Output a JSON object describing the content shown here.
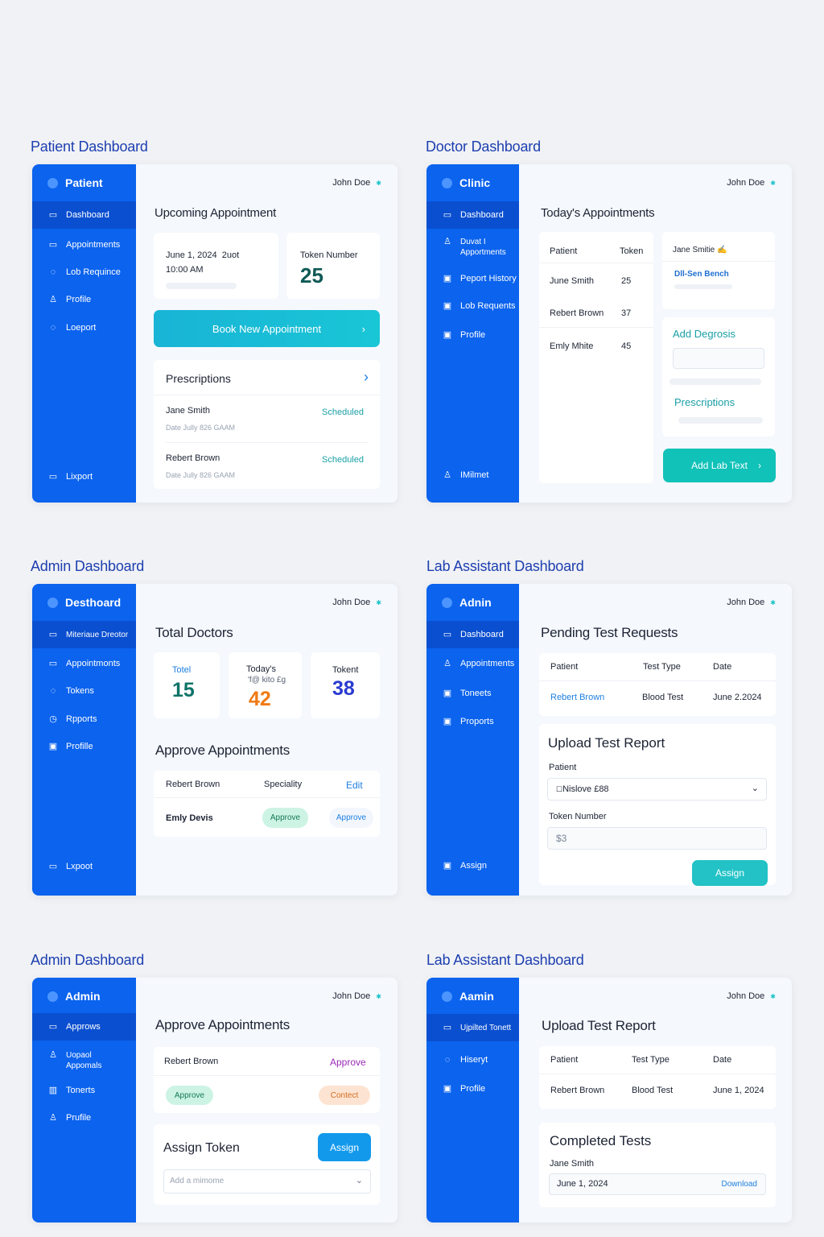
{
  "colors": {
    "sidebar": "#0b63ee",
    "sidebar_active": "#0a4fd0",
    "teal": "#1a9fa5",
    "title": "#1d3fb0"
  },
  "patient": {
    "section_title": "Patient Dashboard",
    "brand": "Patient",
    "nav": [
      "Dashboard",
      "Appointments",
      "Lob Requince",
      "Profile",
      "Loeport"
    ],
    "footer": "Lixport",
    "user": "John Doe",
    "heading": "Upcoming Appointment",
    "appt_date": "June 1, 2024",
    "appt_extra": "2uot",
    "appt_time": "10:00 AM",
    "token_label": "Token Number",
    "token_value": "25",
    "book_button": "Book New Appointment",
    "prescriptions_title": "Prescriptions",
    "rows": [
      {
        "name": "Jane Smith",
        "status": "Scheduled",
        "date": "Date Jully 826 GAAM"
      },
      {
        "name": "Rebert Brown",
        "status": "Scheduled",
        "date": "Date Jully 826 GAAM"
      }
    ]
  },
  "doctor": {
    "section_title": "Doctor Dashboard",
    "brand": "Clinic",
    "nav": [
      "Dashboard",
      "Duvat I Apportments",
      "Peport History",
      "Lob Requents",
      "Profile"
    ],
    "footer": "IMilmet",
    "user": "John Doe",
    "heading": "Today's Appointments",
    "col_patient": "Patient",
    "col_token": "Token",
    "rows": [
      {
        "name": "June Smith",
        "token": "25"
      },
      {
        "name": "Rebert Brown",
        "token": "37"
      },
      {
        "name": "Emly Mhite",
        "token": "45"
      }
    ],
    "side_name": "Jane Smitie",
    "side_link": "Dll-Sen Bench",
    "add_diagnosis": "Add Degrosis",
    "prescriptions": "Prescriptions",
    "add_lab": "Add Lab Text"
  },
  "admin1": {
    "section_title": "Admin Dashboard",
    "brand": "Desthoard",
    "nav": [
      "Miteriaue Dreotor",
      "Appointmonts",
      "Tokens",
      "Rpports",
      "Profille"
    ],
    "footer": "Lxpoot",
    "user": "John Doe",
    "heading": "Total Doctors",
    "stat1_label": "Totel",
    "stat1_value": "15",
    "stat2_label": "Today's",
    "stat2_sub": "'f@ kito £g",
    "stat2_value": "42",
    "stat3_label": "Tokent",
    "stat3_value": "38",
    "approve_heading": "Approve Appointments",
    "row1_name": "Rebert Brown",
    "row1_col": "Speciality",
    "row1_action": "Edit",
    "row2_name": "Emly Devis",
    "row2_pill": "Approve",
    "row2_action": "Approve"
  },
  "lab1": {
    "section_title": "Lab Assistant Dashboard",
    "brand": "Adnin",
    "nav": [
      "Dashboard",
      "Appointments",
      "Toneets",
      "Proports"
    ],
    "footer": "Assign",
    "user": "John Doe",
    "heading": "Pending Test Requests",
    "col_patient": "Patient",
    "col_type": "Test Type",
    "col_date": "Date",
    "row_name": "Rebert Brown",
    "row_type": "Blood Test",
    "row_date": "June 2.2024",
    "upload_heading": "Upload Test Report",
    "patient_label": "Patient",
    "patient_value": "Nislove £88",
    "token_label": "Token Number",
    "token_value": "$3",
    "assign_button": "Assign"
  },
  "admin2": {
    "section_title": "Admin Dashboard",
    "brand": "Admin",
    "nav": [
      "Approws",
      "Uopaol Appomals",
      "Tonerts",
      "Prufile"
    ],
    "user": "John Doe",
    "heading": "Approve Appointments",
    "row1_name": "Rebert Brown",
    "row1_action": "Approve",
    "pill_approve": "Approve",
    "pill_contact": "Contect",
    "assign_heading": "Assign Token",
    "assign_button": "Assign",
    "select_placeholder": "Add a mimome"
  },
  "lab2": {
    "section_title": "Lab Assistant Dashboard",
    "brand": "Aamin",
    "nav": [
      "Ujpilted Tonett",
      "Hiseryt",
      "Profile"
    ],
    "user": "John Doe",
    "heading": "Upload Test Report",
    "col_patient": "Patient",
    "col_type": "Test Type",
    "col_date": "Date",
    "row_name": "Rebert Brown",
    "row_type": "Blood Test",
    "row_date": "June 1, 2024",
    "completed_heading": "Completed Tests",
    "completed_name": "Jane Smith",
    "completed_date": "June 1, 2024",
    "download": "Download"
  }
}
